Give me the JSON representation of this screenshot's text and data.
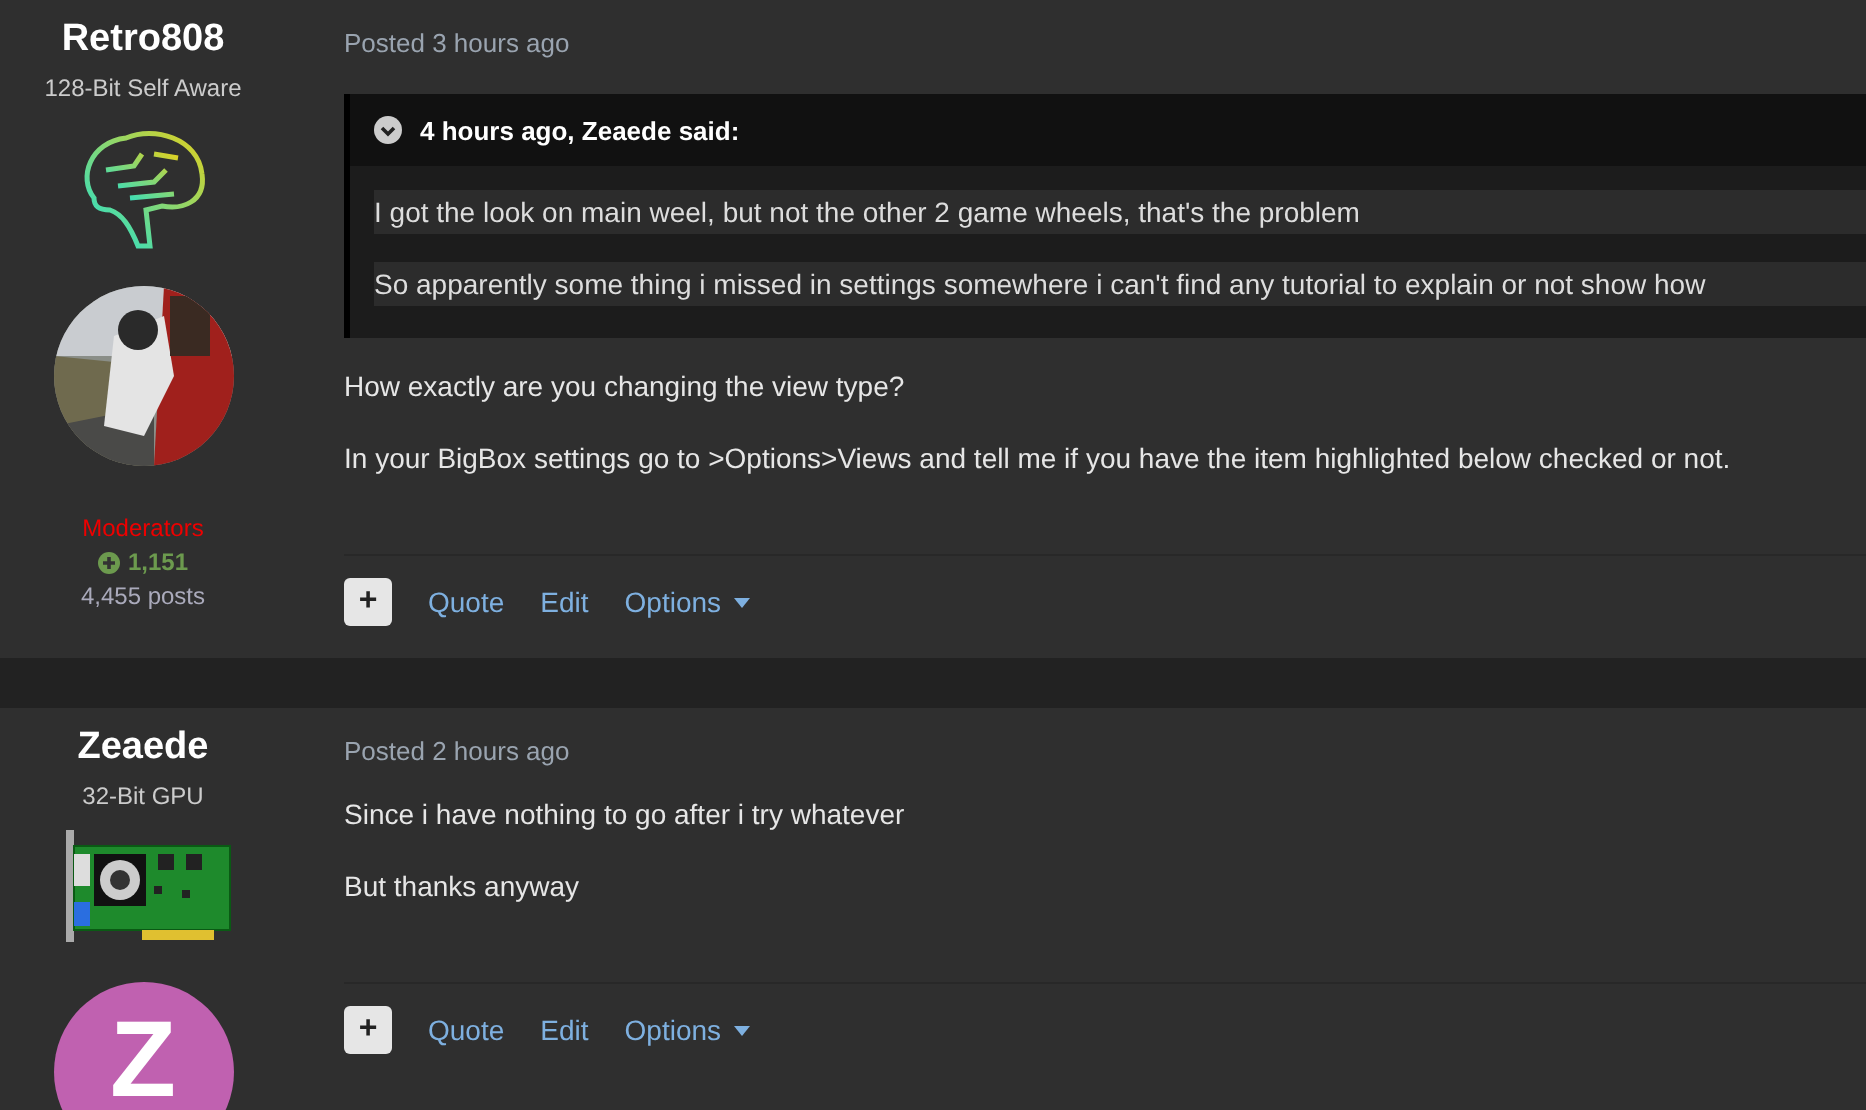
{
  "posts": [
    {
      "author": "Retro808",
      "rank": "128-Bit Self Aware",
      "rank_icon": {
        "kind": "brain"
      },
      "group": "Moderators",
      "reputation": "1,151",
      "post_count": "4,455 posts",
      "posted": "Posted 3 hours ago",
      "quote": {
        "header": "4 hours ago, Zeaede said:",
        "paragraphs": [
          "I got the look on main weel, but not the other 2 game wheels, that's the problem",
          "So apparently some thing i missed in settings somewhere i can't find any tutorial to explain or not show how"
        ]
      },
      "paragraphs": [
        "How exactly are you changing the view type?",
        "In your BigBox settings go to >Options>Views and tell me if you have the item highlighted below checked or not."
      ],
      "actions": {
        "plus": "+",
        "quote": "Quote",
        "edit": "Edit",
        "options": "Options"
      }
    },
    {
      "author": "Zeaede",
      "rank": "32-Bit GPU",
      "rank_icon": {
        "kind": "gpu"
      },
      "avatar": {
        "kind": "letter",
        "letter": "Z",
        "color": "#c061b0"
      },
      "posted": "Posted 2 hours ago",
      "paragraphs": [
        "Since i have nothing to  go after i try whatever",
        "But thanks anyway"
      ],
      "actions": {
        "plus": "+",
        "quote": "Quote",
        "edit": "Edit",
        "options": "Options"
      }
    }
  ]
}
